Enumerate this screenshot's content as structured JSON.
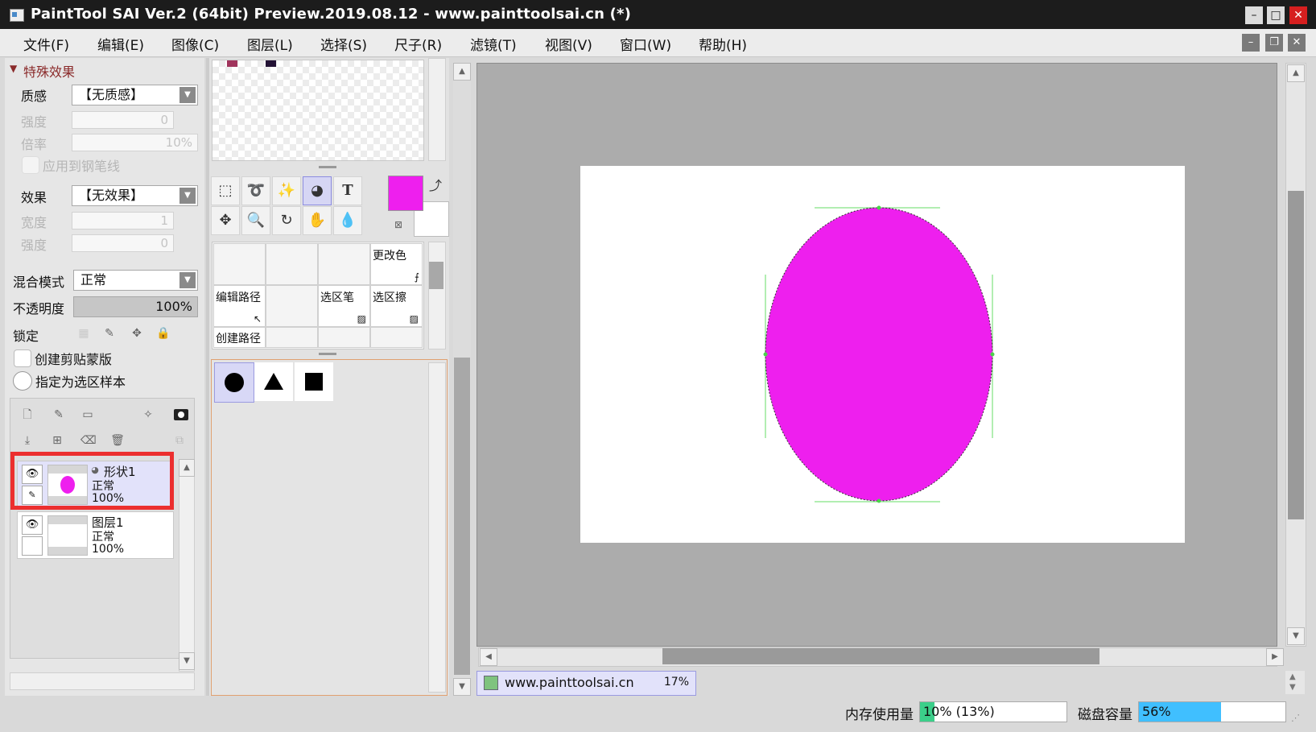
{
  "window": {
    "title": "PaintTool SAI Ver.2 (64bit) Preview.2019.08.12 - www.painttoolsai.cn (*)",
    "min_label": "–",
    "max_label": "□",
    "close_label": "✕"
  },
  "menu": {
    "items": [
      "文件(F)",
      "编辑(E)",
      "图像(C)",
      "图层(L)",
      "选择(S)",
      "尺子(R)",
      "滤镜(T)",
      "视图(V)",
      "窗口(W)",
      "帮助(H)"
    ],
    "mdi_min": "–",
    "mdi_restore": "❐",
    "mdi_close": "✕"
  },
  "effects": {
    "section_title": "特殊效果",
    "texture_label": "质感",
    "texture_value": "【无质感】",
    "strength_label": "强度",
    "strength_value": "0",
    "scale_label": "倍率",
    "scale_value": "10%",
    "apply_pen_label": "应用到钢笔线",
    "effect_label": "效果",
    "effect_value": "【无效果】",
    "width_label": "宽度",
    "width_value": "1",
    "strength2_label": "强度",
    "strength2_value": "0"
  },
  "layer_props": {
    "blend_label": "混合模式",
    "blend_value": "正常",
    "opacity_label": "不透明度",
    "opacity_value": "100%",
    "opacity_fraction": 1.0,
    "lock_label": "锁定",
    "clip_label": "创建剪贴蒙版",
    "selection_source_label": "指定为选区样本"
  },
  "layers": [
    {
      "name": "形状1",
      "mode": "正常",
      "opacity": "100%",
      "selected": true
    },
    {
      "name": "图层1",
      "mode": "正常",
      "opacity": "100%",
      "selected": false
    }
  ],
  "tools": {
    "brush_cells": {
      "change_color": "更改色",
      "edit_path": "编辑路径",
      "select_pen": "选区笔",
      "select_eraser": "选区擦",
      "create_path": "创建路径"
    },
    "primary_color": "#ee1fee",
    "secondary_color": "#ffffff"
  },
  "canvas": {
    "shape_color": "#ee1fee",
    "nav_title": "www.painttoolsai.cn",
    "zoom": "17%"
  },
  "status": {
    "memory_label": "内存使用量",
    "memory_value": "10% (13%)",
    "memory_fraction": 0.1,
    "disk_label": "磁盘容量",
    "disk_value": "56%",
    "disk_fraction": 0.56
  }
}
